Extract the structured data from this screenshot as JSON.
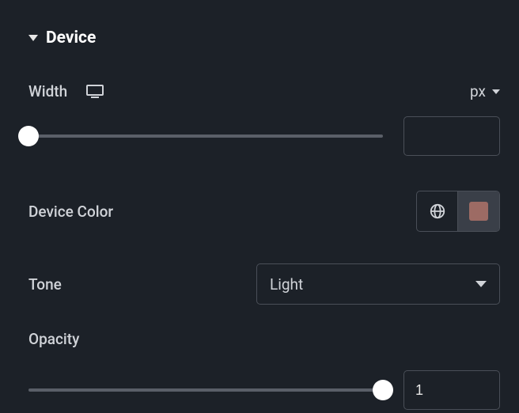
{
  "section": {
    "title": "Device"
  },
  "width": {
    "label": "Width",
    "unit": "px",
    "sliderPosPercent": 0,
    "value": ""
  },
  "deviceColor": {
    "label": "Device Color",
    "swatch": "#9d6b64"
  },
  "tone": {
    "label": "Tone",
    "value": "Light"
  },
  "opacity": {
    "label": "Opacity",
    "sliderPosPercent": 100,
    "value": "1"
  }
}
